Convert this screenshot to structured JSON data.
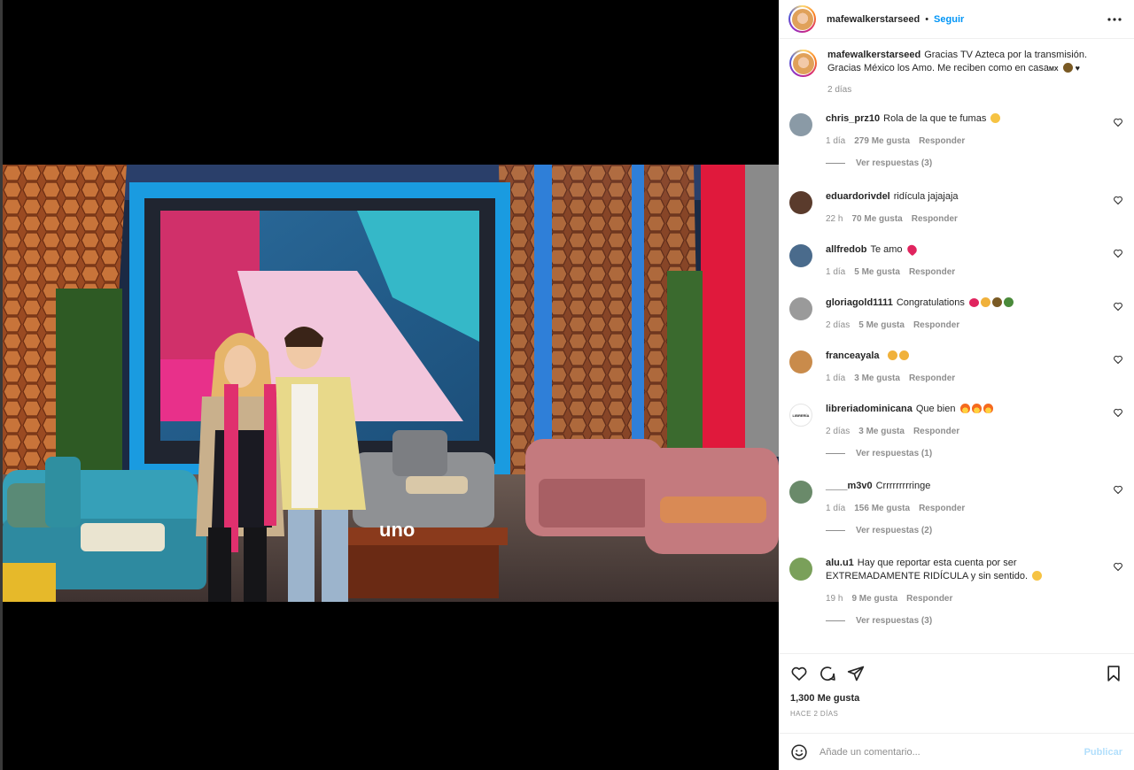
{
  "post": {
    "username": "mafewalkerstarseed",
    "separator": "•",
    "follow_label": "Seguir",
    "caption_line1": "Gracias TV Azteca por la transmisión.",
    "caption_line2": "Gracias México los Amo. Me reciben como en casa",
    "caption_flag": "MX",
    "caption_time": "2 días",
    "photo_logo_text": "uno"
  },
  "comments": [
    {
      "user": "chris_prz10",
      "text": "Rola de la que te fumas",
      "time": "1 día",
      "likes": "279 Me gusta",
      "reply": "Responder",
      "replies": "Ver respuestas (3)",
      "avatar_color": "#8a9aa6",
      "emoji": "yellow"
    },
    {
      "user": "eduardorivdel",
      "text": "ridícula jajajaja",
      "time": "22 h",
      "likes": "70 Me gusta",
      "reply": "Responder",
      "avatar_color": "#5a3b2c"
    },
    {
      "user": "allfredob",
      "text": "Te amo",
      "time": "1 día",
      "likes": "5 Me gusta",
      "reply": "Responder",
      "avatar_color": "#4a6b8c",
      "emoji": "red-heart"
    },
    {
      "user": "gloriagold1111",
      "text": "Congratulations",
      "time": "2 días",
      "likes": "5 Me gusta",
      "reply": "Responder",
      "avatar_color": "#9a9a9a",
      "emoji": "party"
    },
    {
      "user": "franceayala",
      "text": "",
      "time": "1 día",
      "likes": "3 Me gusta",
      "reply": "Responder",
      "avatar_color": "#c98b4b",
      "emoji": "clap"
    },
    {
      "user": "libreriadominicana",
      "text": "Que bien",
      "time": "2 días",
      "likes": "3 Me gusta",
      "reply": "Responder",
      "replies": "Ver respuestas (1)",
      "avatar_color": "#ffffff",
      "avatar_text": "LIBRERÍA",
      "emoji": "fire"
    },
    {
      "user": "____m3v0",
      "text": "Crrrrrrrrringe",
      "time": "1 día",
      "likes": "156 Me gusta",
      "reply": "Responder",
      "replies": "Ver respuestas (2)",
      "avatar_color": "#6a8a6a"
    },
    {
      "user": "alu.u1",
      "text": "Hay que reportar esta cuenta por ser",
      "text2": "EXTREMADAMENTE RIDÍCULA y sin sentido.",
      "time": "19 h",
      "likes": "9 Me gusta",
      "reply": "Responder",
      "replies": "Ver respuestas (3)",
      "avatar_color": "#7aa05a",
      "emoji": "yellow"
    }
  ],
  "actions": {
    "likes": "1,300 Me gusta",
    "ago": "HACE 2 DÍAS",
    "icons": [
      "heart-icon",
      "comment-icon",
      "share-icon",
      "bookmark-icon"
    ]
  },
  "composer": {
    "placeholder": "Añade un comentario...",
    "publish_label": "Publicar"
  },
  "colors": {
    "link_blue": "#0095f6",
    "publish_disabled": "#b2dffc",
    "muted": "#8e8e8e",
    "text": "#262626"
  }
}
